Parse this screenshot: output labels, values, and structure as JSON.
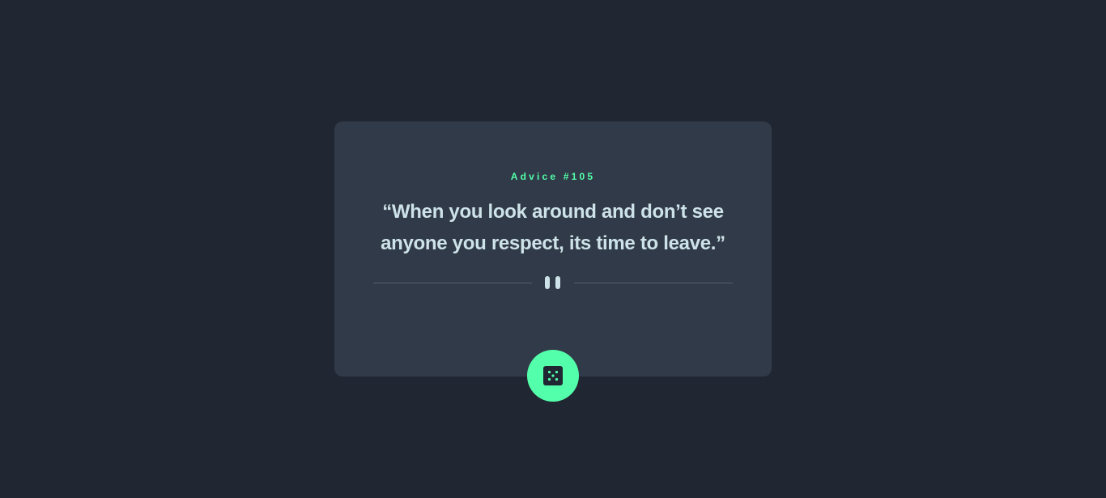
{
  "advice": {
    "id_label": "Advice #105",
    "quote": "“When you look around and don’t see anyone you respect, its time to leave.”"
  },
  "divider": {
    "icon": "pause-icon"
  },
  "dice_button": {
    "icon": "dice-icon",
    "accent_color": "#53ffaa"
  },
  "theme": {
    "background": "#202632",
    "card": "#313a48",
    "accent": "#53ffaa",
    "text": "#cee3e9",
    "divider": "#4f5d74"
  }
}
